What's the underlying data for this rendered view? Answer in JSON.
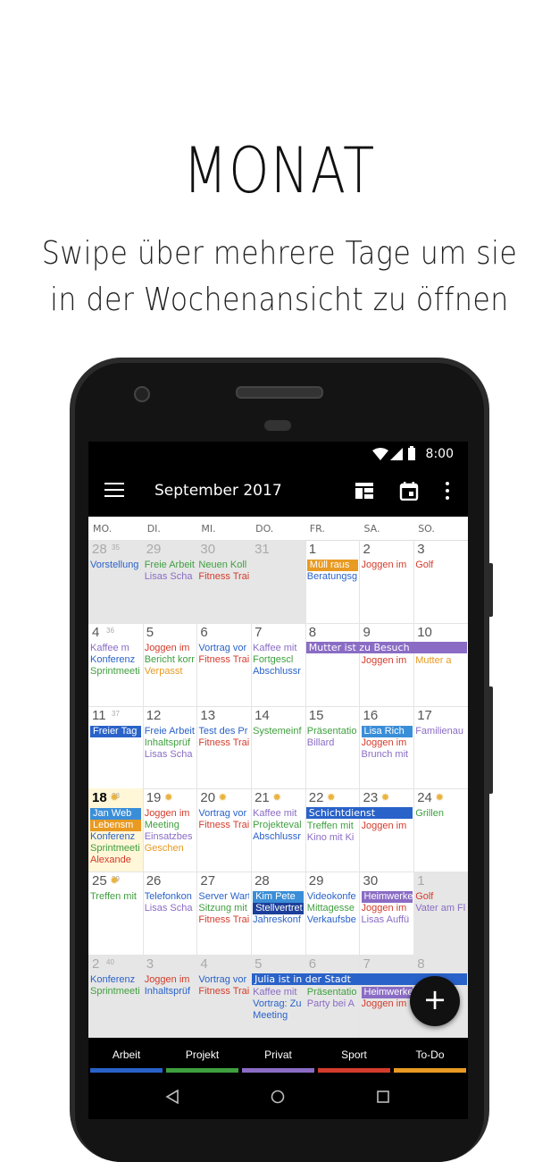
{
  "headline": "MONAT",
  "subtitle_line1": "Swipe über mehrere Tage um sie",
  "subtitle_line2": "in der Wochenansicht zu öffnen",
  "status": {
    "time": "8:00"
  },
  "toolbar": {
    "title": "September 2017"
  },
  "weekdays": [
    "MO.",
    "DI.",
    "MI.",
    "DO.",
    "FR.",
    "SA.",
    "SO."
  ],
  "colors": {
    "arbeit": "#2962c9",
    "projekt": "#3f9f3f",
    "privat": "#8a6cc4",
    "sport": "#d33c2c",
    "todo": "#e89a23"
  },
  "weeks": [
    {
      "week": "35",
      "days": [
        "28",
        "29",
        "30",
        "31",
        "1",
        "2",
        "3"
      ]
    },
    {
      "week": "36",
      "days": [
        "4",
        "5",
        "6",
        "7",
        "8",
        "9",
        "10"
      ]
    },
    {
      "week": "37",
      "days": [
        "11",
        "12",
        "13",
        "14",
        "15",
        "16",
        "17"
      ]
    },
    {
      "week": "38",
      "days": [
        "18",
        "19",
        "20",
        "21",
        "22",
        "23",
        "24"
      ]
    },
    {
      "week": "39",
      "days": [
        "25",
        "26",
        "27",
        "28",
        "29",
        "30",
        "1"
      ]
    },
    {
      "week": "40",
      "days": [
        "2",
        "3",
        "4",
        "5",
        "6",
        "7",
        "8"
      ]
    }
  ],
  "events": {
    "w0d0": [
      "Vorstellung"
    ],
    "w0d1": [
      "Freie Arbeit",
      "Lisas Scha"
    ],
    "w0d2": [
      "Neuen Koll",
      "Fitness Trai"
    ],
    "w0d4": [
      "Müll raus",
      "Beratungsg"
    ],
    "w0d5": [
      "Joggen im"
    ],
    "w0d6": [
      "Golf"
    ],
    "w1d0": [
      "Kaffee m",
      "Konferenz",
      "Sprintmeeti"
    ],
    "w1d1": [
      "Joggen im",
      "Bericht korr",
      "Verpasst"
    ],
    "w1d2": [
      "Vortrag vor",
      "Fitness Trai"
    ],
    "w1d3": [
      "Kaffee mit",
      "Fortgescl",
      "Abschlussr"
    ],
    "w1span": "Mutter ist zu Besuch",
    "w1d5": [
      "Joggen im"
    ],
    "w1d6": [
      "Mutter a"
    ],
    "w2d0": [
      "Freier Tag"
    ],
    "w2d1": [
      "Freie Arbeit",
      "Inhaltsprüf",
      "Lisas Scha"
    ],
    "w2d2": [
      "Test des Pr",
      "Fitness Trai"
    ],
    "w2d3": [
      "Systemeinf"
    ],
    "w2d4": [
      "Präsentatio",
      "Billard"
    ],
    "w2d5": [
      "Lisa Rich",
      "Joggen im",
      "Brunch mit"
    ],
    "w2d6": [
      "Familienau"
    ],
    "w3d0": [
      "Jan Web",
      "Lebensm",
      "Konferenz",
      "Sprintmeeti",
      "Alexande"
    ],
    "w3d1": [
      "Joggen im",
      "Meeting",
      "Einsatzbes",
      "Geschen"
    ],
    "w3d2": [
      "Vortrag vor",
      "Fitness Trai"
    ],
    "w3d3": [
      "Kaffee mit",
      "Projekteval",
      "Abschlussr"
    ],
    "w3span": "Schichtdienst",
    "w3d4": [
      "Treffen mit",
      "Kino mit Ki"
    ],
    "w3d5": [
      "Joggen im"
    ],
    "w3d6": [
      "Grillen"
    ],
    "w4d0": [
      "Treffen mit"
    ],
    "w4d1": [
      "Telefonkon",
      "Lisas Scha"
    ],
    "w4d2": [
      "Server Wart",
      "Sitzung mit",
      "Fitness Trai"
    ],
    "w4d3": [
      "Kim Pete",
      "Stellvertret",
      "Jahreskonf"
    ],
    "w4d4": [
      "Videokonfe",
      "Mittagesse",
      "Verkaufsbe"
    ],
    "w4d5": [
      "Heimwerke",
      "Joggen im",
      "Lisas Auffü"
    ],
    "w4d6": [
      "Golf",
      "Vater am Fl"
    ],
    "w5d0": [
      "Konferenz",
      "Sprintmeeti"
    ],
    "w5d1": [
      "Joggen im",
      "Inhaltsprüf"
    ],
    "w5d2": [
      "Vortrag vor",
      "Fitness Trai"
    ],
    "w5span": "Julia ist in der Stadt",
    "w5d3": [
      "Kaffee mit",
      "Vortrag: Zu",
      "Meeting"
    ],
    "w5d4": [
      "Präsentatio",
      "Party bei A"
    ],
    "w5d5": [
      "Heimwerke",
      "Joggen im"
    ]
  },
  "fab": "+",
  "tabs": [
    "Arbeit",
    "Projekt",
    "Privat",
    "Sport",
    "To-Do"
  ]
}
